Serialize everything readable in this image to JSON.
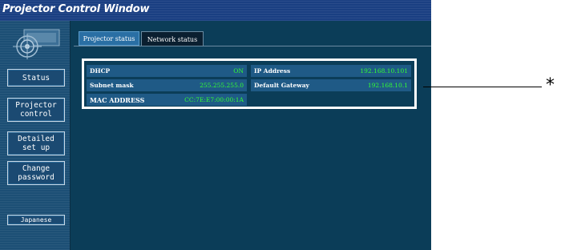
{
  "window": {
    "title": "Projector Control Window"
  },
  "sidebar": {
    "items": [
      {
        "label": "Status"
      },
      {
        "label": "Projector\ncontrol"
      },
      {
        "label": "Detailed\nset up"
      },
      {
        "label": "Change\npassword"
      },
      {
        "label": "Japanese"
      }
    ]
  },
  "tabs": [
    {
      "label": "Projector status",
      "active": false
    },
    {
      "label": "Network status",
      "active": true
    }
  ],
  "network": {
    "dhcp": {
      "label": "DHCP",
      "value": "ON"
    },
    "subnet": {
      "label": "Subnet mask",
      "value": "255.255.255.0"
    },
    "mac": {
      "label": "MAC ADDRESS",
      "value": "CC:7E:E7:00:00:1A"
    },
    "ip": {
      "label": "IP Address",
      "value": "192.168.10.101"
    },
    "gateway": {
      "label": "Default Gateway",
      "value": "192.168.10.1"
    }
  },
  "callout": {
    "mark": "*"
  },
  "colors": {
    "title_bar": "#1a3f82",
    "background": "#0b3d58",
    "value_green": "#33ff33",
    "highlight_border": "#ffffff"
  }
}
